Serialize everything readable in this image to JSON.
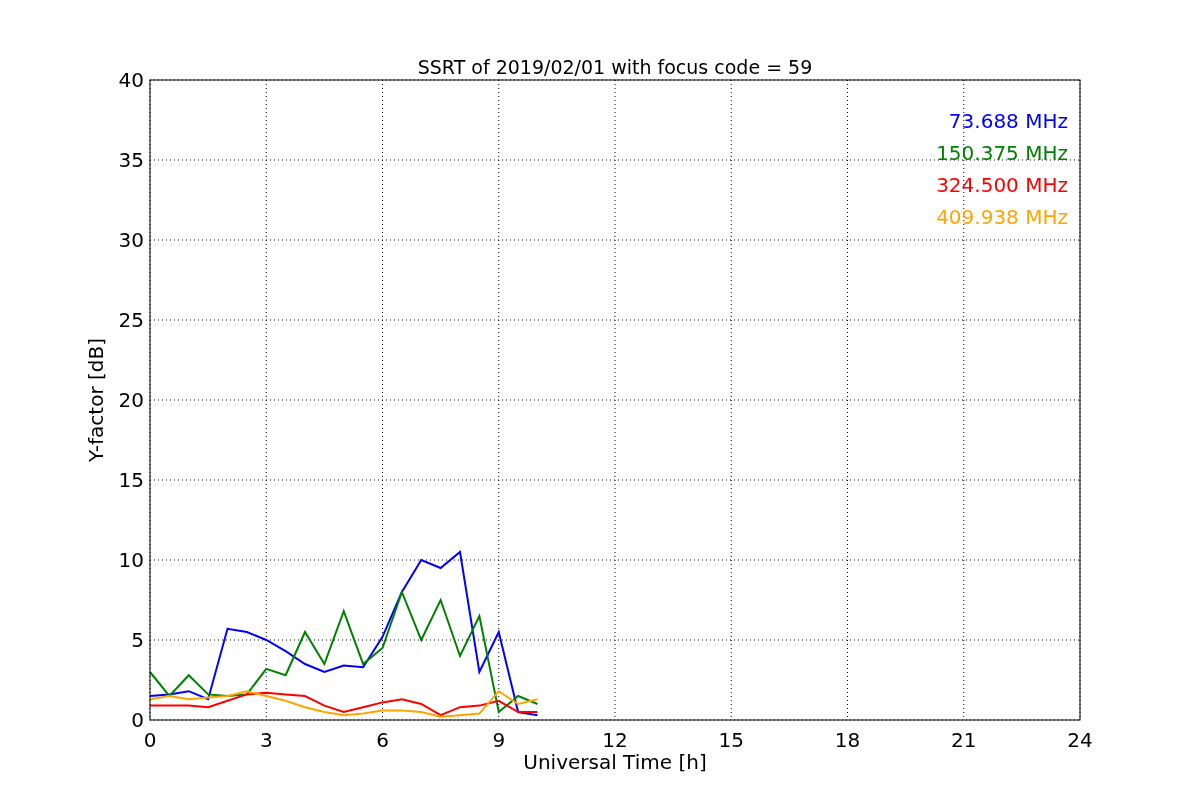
{
  "chart_data": {
    "type": "line",
    "title": "SSRT of 2019/02/01 with focus code = 59",
    "xlabel": "Universal Time [h]",
    "ylabel": "Y-factor [dB]",
    "x": [
      0,
      0.5,
      1,
      1.5,
      2,
      2.5,
      3,
      3.5,
      4,
      4.5,
      5,
      5.5,
      6,
      6.5,
      7,
      7.5,
      8,
      8.5,
      9,
      9.5,
      10
    ],
    "series": [
      {
        "name": "73.688 MHz",
        "color": "#0000ff",
        "values": [
          1.5,
          1.6,
          1.8,
          1.3,
          5.7,
          5.5,
          5.0,
          4.3,
          3.5,
          3.0,
          3.4,
          3.3,
          5.2,
          8.0,
          10.0,
          9.5,
          10.5,
          3.0,
          5.5,
          0.5,
          0.3
        ]
      },
      {
        "name": "150.375 MHz",
        "color": "#008000",
        "values": [
          3.0,
          1.5,
          2.8,
          1.6,
          1.5,
          1.6,
          3.2,
          2.8,
          5.5,
          3.5,
          6.8,
          3.5,
          4.5,
          8.0,
          5.0,
          7.5,
          4.0,
          6.5,
          0.5,
          1.5,
          1.0
        ]
      },
      {
        "name": "324.500 MHz",
        "color": "#ff0000",
        "values": [
          0.9,
          0.9,
          0.9,
          0.8,
          1.2,
          1.6,
          1.7,
          1.6,
          1.5,
          0.9,
          0.5,
          0.8,
          1.1,
          1.3,
          1.0,
          0.3,
          0.8,
          0.9,
          1.2,
          0.5,
          0.5
        ]
      },
      {
        "name": "409.938 MHz",
        "color": "#ffa500",
        "values": [
          1.3,
          1.5,
          1.3,
          1.4,
          1.5,
          1.8,
          1.5,
          1.2,
          0.8,
          0.5,
          0.3,
          0.4,
          0.6,
          0.6,
          0.5,
          0.2,
          0.3,
          0.4,
          1.8,
          1.0,
          1.3
        ]
      }
    ],
    "xlim": [
      0,
      24
    ],
    "ylim": [
      0,
      40
    ],
    "grid": true,
    "xticks": [
      0,
      3,
      6,
      9,
      12,
      15,
      18,
      21,
      24
    ],
    "yticks": [
      0,
      5,
      10,
      15,
      20,
      25,
      30,
      35,
      40
    ]
  }
}
